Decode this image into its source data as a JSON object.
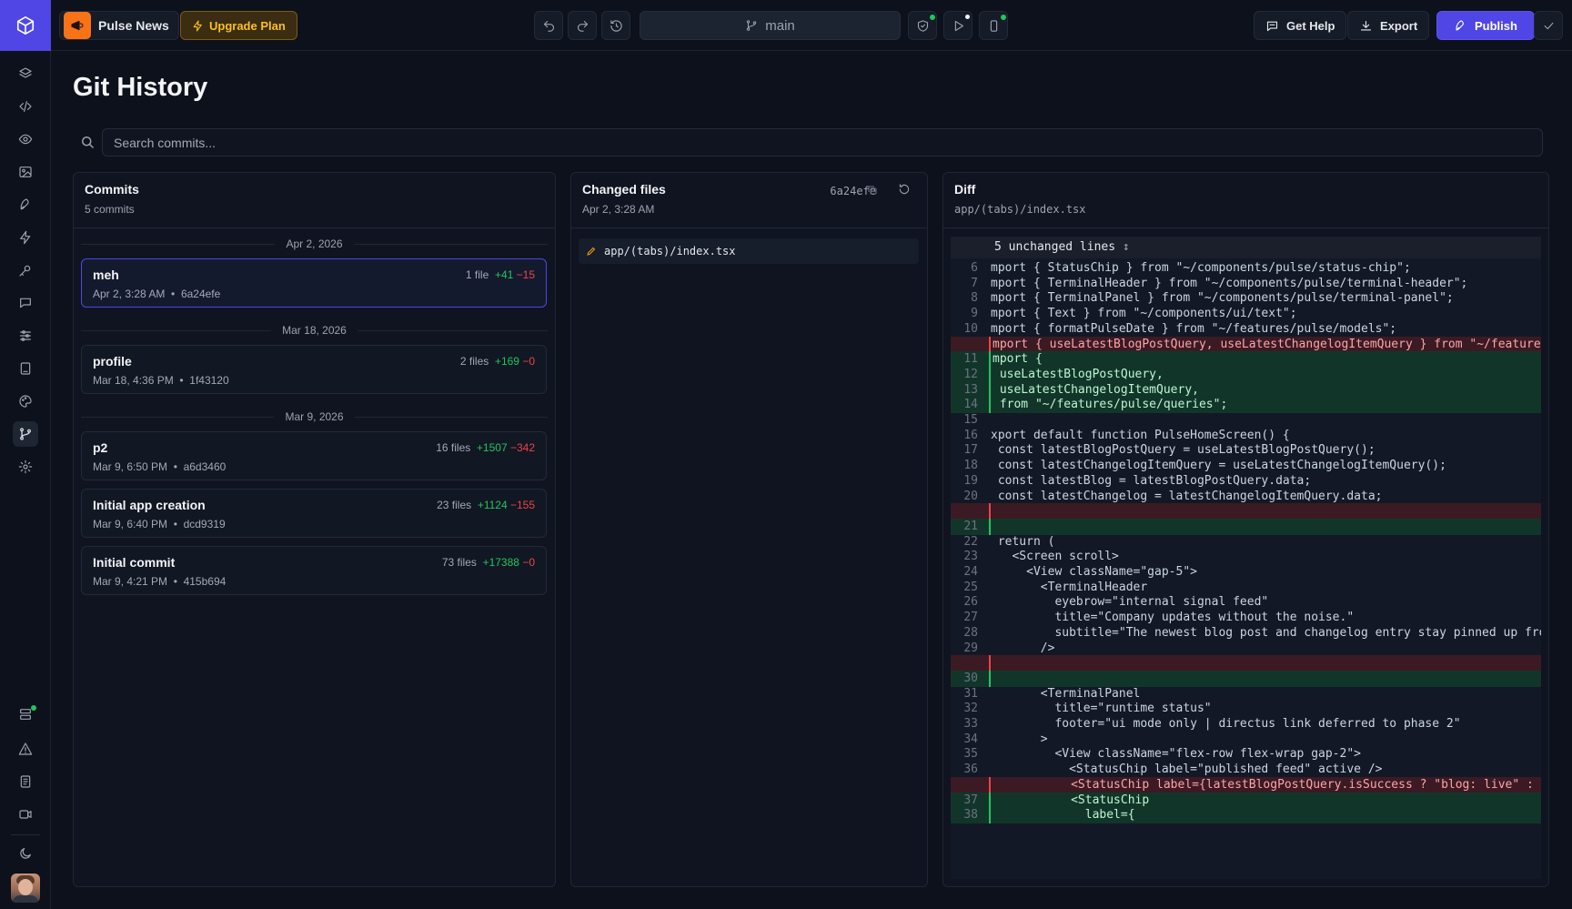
{
  "app": {
    "project_name": "Pulse News",
    "upgrade_label": "Upgrade Plan",
    "branch": "main"
  },
  "toolbar": {
    "help_label": "Get Help",
    "export_label": "Export",
    "publish_label": "Publish"
  },
  "colors": {
    "accent": "#4f46e5",
    "brand": "#f97316",
    "added": "#22c55e",
    "removed": "#ef4444",
    "warning": "#fbbf24"
  },
  "page": {
    "title": "Git History",
    "search_placeholder": "Search commits..."
  },
  "commits_panel": {
    "title": "Commits",
    "count": "5 commits",
    "groups": [
      {
        "date": "Apr 2, 2026",
        "commits": [
          {
            "message": "meh",
            "time": "Apr 2, 3:28 AM",
            "hash": "6a24efe",
            "files": "1 file",
            "added": "+41",
            "removed": "−15",
            "selected": true
          }
        ]
      },
      {
        "date": "Mar 18, 2026",
        "commits": [
          {
            "message": "profile",
            "time": "Mar 18, 4:36 PM",
            "hash": "1f43120",
            "files": "2 files",
            "added": "+169",
            "removed": "−0"
          }
        ]
      },
      {
        "date": "Mar 9, 2026",
        "commits": [
          {
            "message": "p2",
            "time": "Mar 9, 6:50 PM",
            "hash": "a6d3460",
            "files": "16 files",
            "added": "+1507",
            "removed": "−342"
          },
          {
            "message": "Initial app creation",
            "time": "Mar 9, 6:40 PM",
            "hash": "dcd9319",
            "files": "23 files",
            "added": "+1124",
            "removed": "−155"
          },
          {
            "message": "Initial commit",
            "time": "Mar 9, 4:21 PM",
            "hash": "415b694",
            "files": "73 files",
            "added": "+17388",
            "removed": "−0"
          }
        ]
      }
    ]
  },
  "files_panel": {
    "title": "Changed files",
    "date": "Apr 2, 3:28 AM",
    "hash": "6a24efe",
    "files": [
      {
        "path": "app/(tabs)/index.tsx",
        "status": "modified"
      }
    ]
  },
  "diff_panel": {
    "title": "Diff",
    "path": "app/(tabs)/index.tsx",
    "unchanged_label": "5 unchanged lines",
    "lines": [
      {
        "n": "6",
        "type": "ctx",
        "code": "mport { StatusChip } from \"~/components/pulse/status-chip\";"
      },
      {
        "n": "7",
        "type": "ctx",
        "code": "mport { TerminalHeader } from \"~/components/pulse/terminal-header\";"
      },
      {
        "n": "8",
        "type": "ctx",
        "code": "mport { TerminalPanel } from \"~/components/pulse/terminal-panel\";"
      },
      {
        "n": "9",
        "type": "ctx",
        "code": "mport { Text } from \"~/components/ui/text\";"
      },
      {
        "n": "10",
        "type": "ctx",
        "code": "mport { formatPulseDate } from \"~/features/pulse/models\";"
      },
      {
        "n": "",
        "type": "del",
        "code": "mport { useLatestBlogPostQuery, useLatestChangelogItemQuery } from \"~/features/pulse/queries\";"
      },
      {
        "n": "11",
        "type": "add",
        "code": "mport {"
      },
      {
        "n": "12",
        "type": "add",
        "code": " useLatestBlogPostQuery,"
      },
      {
        "n": "13",
        "type": "add",
        "code": " useLatestChangelogItemQuery,"
      },
      {
        "n": "14",
        "type": "add",
        "code": " from \"~/features/pulse/queries\";"
      },
      {
        "n": "15",
        "type": "ctx",
        "code": ""
      },
      {
        "n": "16",
        "type": "ctx",
        "code": "xport default function PulseHomeScreen() {"
      },
      {
        "n": "17",
        "type": "ctx",
        "code": " const latestBlogPostQuery = useLatestBlogPostQuery();"
      },
      {
        "n": "18",
        "type": "ctx",
        "code": " const latestChangelogItemQuery = useLatestChangelogItemQuery();"
      },
      {
        "n": "19",
        "type": "ctx",
        "code": " const latestBlog = latestBlogPostQuery.data;"
      },
      {
        "n": "20",
        "type": "ctx",
        "code": " const latestChangelog = latestChangelogItemQuery.data;"
      },
      {
        "n": "",
        "type": "del",
        "code": ""
      },
      {
        "n": "21",
        "type": "add",
        "code": ""
      },
      {
        "n": "22",
        "type": "ctx",
        "code": " return ("
      },
      {
        "n": "23",
        "type": "ctx",
        "code": "   <Screen scroll>"
      },
      {
        "n": "24",
        "type": "ctx",
        "code": "     <View className=\"gap-5\">"
      },
      {
        "n": "25",
        "type": "ctx",
        "code": "       <TerminalHeader"
      },
      {
        "n": "26",
        "type": "ctx",
        "code": "         eyebrow=\"internal signal feed\""
      },
      {
        "n": "27",
        "type": "ctx",
        "code": "         title=\"Company updates without the noise.\""
      },
      {
        "n": "28",
        "type": "ctx",
        "code": "         subtitle=\"The newest blog post and changelog entry stay pinned up front\""
      },
      {
        "n": "29",
        "type": "ctx",
        "code": "       />"
      },
      {
        "n": "",
        "type": "del",
        "code": ""
      },
      {
        "n": "30",
        "type": "add",
        "code": ""
      },
      {
        "n": "31",
        "type": "ctx",
        "code": "       <TerminalPanel"
      },
      {
        "n": "32",
        "type": "ctx",
        "code": "         title=\"runtime status\""
      },
      {
        "n": "33",
        "type": "ctx",
        "code": "         footer=\"ui mode only | directus link deferred to phase 2\""
      },
      {
        "n": "34",
        "type": "ctx",
        "code": "       >"
      },
      {
        "n": "35",
        "type": "ctx",
        "code": "         <View className=\"flex-row flex-wrap gap-2\">"
      },
      {
        "n": "36",
        "type": "ctx",
        "code": "           <StatusChip label=\"published feed\" active />"
      },
      {
        "n": "",
        "type": "del",
        "code": "           <StatusChip label={latestBlogPostQuery.isSuccess ? \"blog: live\" : \""
      },
      {
        "n": "37",
        "type": "add",
        "code": "           <StatusChip"
      },
      {
        "n": "38",
        "type": "add",
        "code": "             label={"
      }
    ]
  }
}
